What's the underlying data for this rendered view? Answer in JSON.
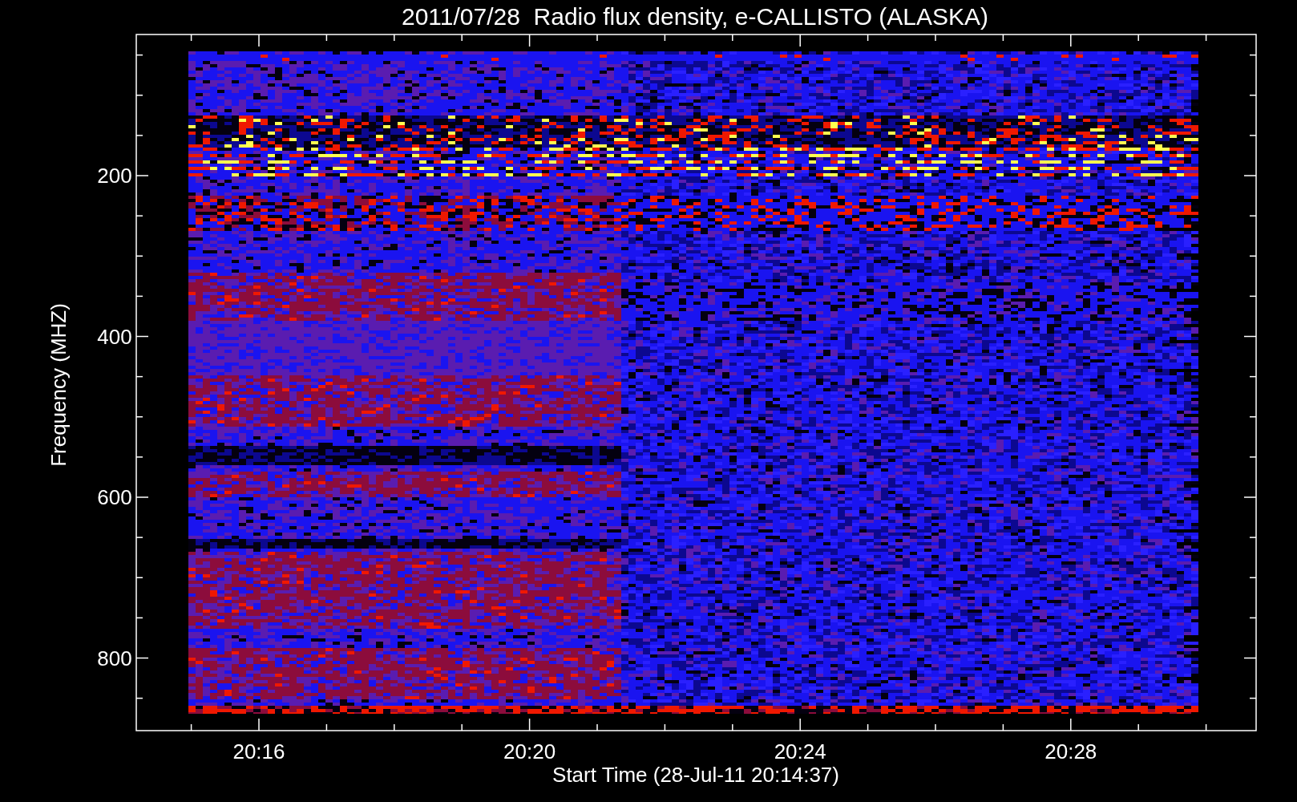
{
  "title": "2011/07/28  Radio flux density, e-CALLISTO (ALASKA)",
  "ylabel": "Frequency (MHZ)",
  "xlabel": "Start Time (28-Jul-11 20:14:37)",
  "y_ticks": [
    "200",
    "400",
    "600",
    "800"
  ],
  "x_ticks": [
    "20:16",
    "20:20",
    "20:24",
    "20:28"
  ]
}
